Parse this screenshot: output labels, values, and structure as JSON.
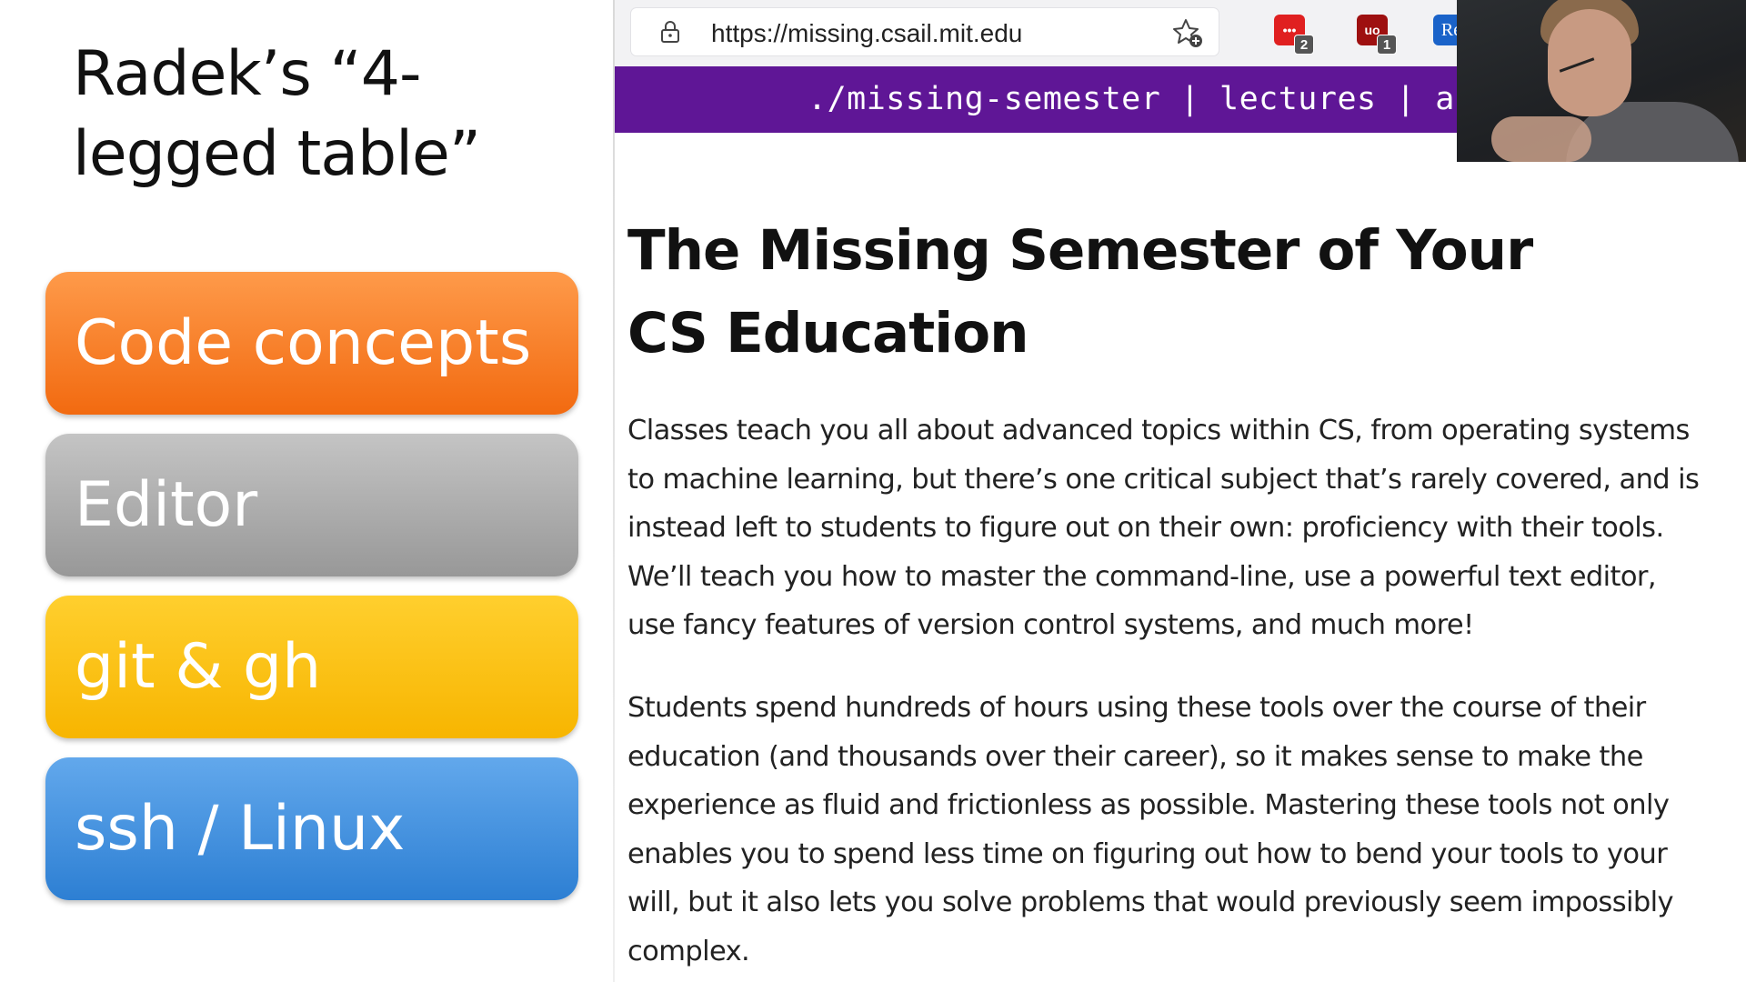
{
  "slide": {
    "title_line1": "Radek’s “4-",
    "title_line2": "legged table”",
    "items": [
      {
        "label": "Code concepts",
        "color": "#f57c21"
      },
      {
        "label": "Editor",
        "color": "#a9a9a9"
      },
      {
        "label": "git & gh",
        "color": "#fcbf0f"
      },
      {
        "label": "ssh / Linux",
        "color": "#3f8fdc"
      }
    ]
  },
  "browser": {
    "url": "https://missing.csail.mit.edu",
    "extensions": [
      {
        "icon": "dots-extension-icon",
        "badge": "2",
        "color": "#e02020"
      },
      {
        "icon": "ublock-extension-icon",
        "badge": "1",
        "color": "#9e1010"
      },
      {
        "icon": "re-extension-icon",
        "text": "Re",
        "color": "#1a63c9"
      }
    ],
    "nav": "./missing-semester | lectures | a",
    "nav_color": "#5f1696"
  },
  "page": {
    "title": "The Missing Semester of Your CS Education",
    "para1_lines": [
      "Classes teach you all about advanced topics within CS, from operating systems",
      "to machine learning, but there’s one critical subject that’s rarely covered, and is",
      "instead left to students to figure out on their own: proficiency with their tools.",
      "We’ll teach you how to master the command-line, use a powerful text editor,",
      "use fancy features of version control systems, and much more!"
    ],
    "para2_lines": [
      "Students spend hundreds of hours using these tools over the course of their",
      "education (and thousands over their career), so it makes sense to make the",
      "experience as fluid and frictionless as possible. Mastering these tools not only",
      "enables you to spend less time on figuring out how to bend your tools to your",
      "will, but it also lets you solve problems that would previously seem impossibly",
      "complex."
    ]
  }
}
